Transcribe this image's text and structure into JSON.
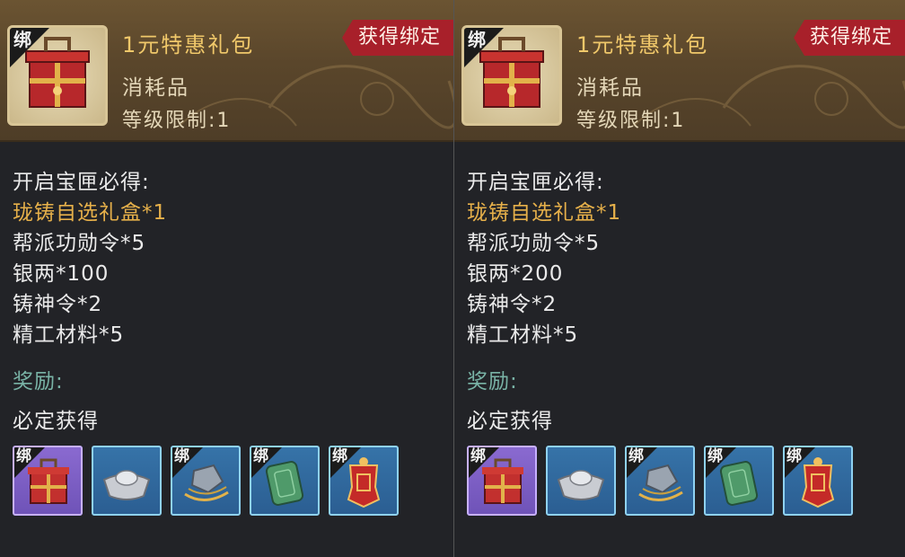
{
  "panels": [
    {
      "bind_tag": "绑",
      "item_name": "1元特惠礼包",
      "item_type": "消耗品",
      "level_limit": "等级限制:1",
      "bind_ribbon": "获得绑定",
      "contents_heading": "开启宝匣必得:",
      "contents": [
        {
          "text": "珑铸自选礼盒*1",
          "highlight": true
        },
        {
          "text": "帮派功勋令*5",
          "highlight": false
        },
        {
          "text": "银两*100",
          "highlight": false
        },
        {
          "text": "铸神令*2",
          "highlight": false
        },
        {
          "text": "精工材料*5",
          "highlight": false
        }
      ],
      "reward_heading": "奖励:",
      "guaranteed_heading": "必定获得",
      "reward_slots": [
        {
          "icon": "gift-box-icon",
          "rarity": "purple",
          "bound": true
        },
        {
          "icon": "silver-ingot-icon",
          "rarity": "blue",
          "bound": false
        },
        {
          "icon": "forge-material-icon",
          "rarity": "blue",
          "bound": true
        },
        {
          "icon": "jade-token-icon",
          "rarity": "blue",
          "bound": true
        },
        {
          "icon": "red-merit-token-icon",
          "rarity": "blue",
          "bound": true
        }
      ]
    },
    {
      "bind_tag": "绑",
      "item_name": "1元特惠礼包",
      "item_type": "消耗品",
      "level_limit": "等级限制:1",
      "bind_ribbon": "获得绑定",
      "contents_heading": "开启宝匣必得:",
      "contents": [
        {
          "text": "珑铸自选礼盒*1",
          "highlight": true
        },
        {
          "text": "帮派功勋令*5",
          "highlight": false
        },
        {
          "text": "银两*200",
          "highlight": false
        },
        {
          "text": "铸神令*2",
          "highlight": false
        },
        {
          "text": "精工材料*5",
          "highlight": false
        }
      ],
      "reward_heading": "奖励:",
      "guaranteed_heading": "必定获得",
      "reward_slots": [
        {
          "icon": "gift-box-icon",
          "rarity": "purple",
          "bound": true
        },
        {
          "icon": "silver-ingot-icon",
          "rarity": "blue",
          "bound": false
        },
        {
          "icon": "forge-material-icon",
          "rarity": "blue",
          "bound": true
        },
        {
          "icon": "jade-token-icon",
          "rarity": "blue",
          "bound": true
        },
        {
          "icon": "red-merit-token-icon",
          "rarity": "blue",
          "bound": true
        }
      ]
    }
  ],
  "colors": {
    "title_gold": "#f0c86a",
    "highlight_orange": "#e6b04a",
    "reward_teal": "#79b3a6",
    "ribbon_red": "#a8202a",
    "slot_blue": "#3673a8",
    "slot_purple": "#8a6ad0"
  }
}
